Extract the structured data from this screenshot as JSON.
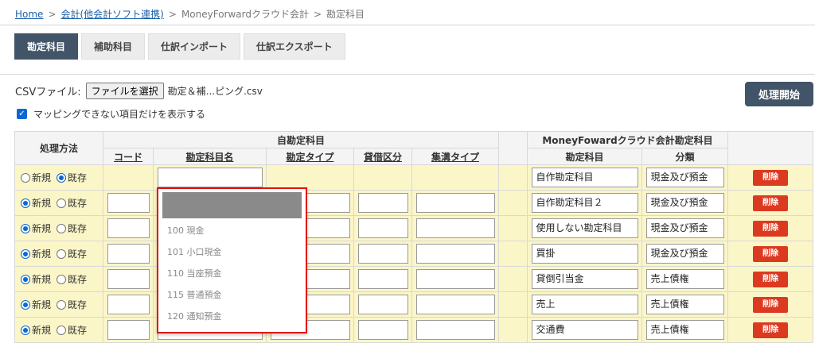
{
  "breadcrumb": {
    "home": "Home",
    "kaikei": "会計(他会計ソフト連携)",
    "mf": "MoneyForwardクラウド会計",
    "current": "勘定科目",
    "separator": ">"
  },
  "tabs": [
    {
      "label": "勘定科目",
      "active": true
    },
    {
      "label": "補助科目",
      "active": false
    },
    {
      "label": "仕訳インポート",
      "active": false
    },
    {
      "label": "仕訳エクスポート",
      "active": false
    }
  ],
  "csv": {
    "label": "CSVファイル:",
    "button": "ファイルを選択",
    "filename": "勘定＆補...ピング.csv"
  },
  "filter_checkbox": {
    "label": "マッピングできない項目だけを表示する",
    "checked": true
  },
  "start_button": "処理開始",
  "table": {
    "method_header": "処理方法",
    "own_group": "自勘定科目",
    "mf_group": "MoneyFowardクラウド会計勘定科目",
    "own_columns": [
      "コード",
      "勘定科目名",
      "勘定タイプ",
      "貸借区分",
      "集溝タイプ"
    ],
    "mf_columns": [
      "勘定科目",
      "分類"
    ],
    "radio_new": "新規",
    "radio_existing": "既存",
    "delete_label": "削除",
    "rows": [
      {
        "method": "existing",
        "account": "自作勘定科目",
        "category": "現金及び預金"
      },
      {
        "method": "new",
        "account": "自作勘定科目２",
        "category": "現金及び預金"
      },
      {
        "method": "new",
        "account": "使用しない勘定科目",
        "category": "現金及び預金"
      },
      {
        "method": "new",
        "account": "買掛",
        "category": "現金及び預金"
      },
      {
        "method": "new",
        "account": "貸倒引当金",
        "category": "売上債権"
      },
      {
        "method": "new",
        "account": "売上",
        "category": "売上債権"
      },
      {
        "method": "new",
        "account": "交通費",
        "category": "売上債権"
      }
    ]
  },
  "dropdown": {
    "items": [
      "100 現金",
      "101 小口現金",
      "110 当座預金",
      "115 普通預金",
      "120 通知預金"
    ]
  }
}
